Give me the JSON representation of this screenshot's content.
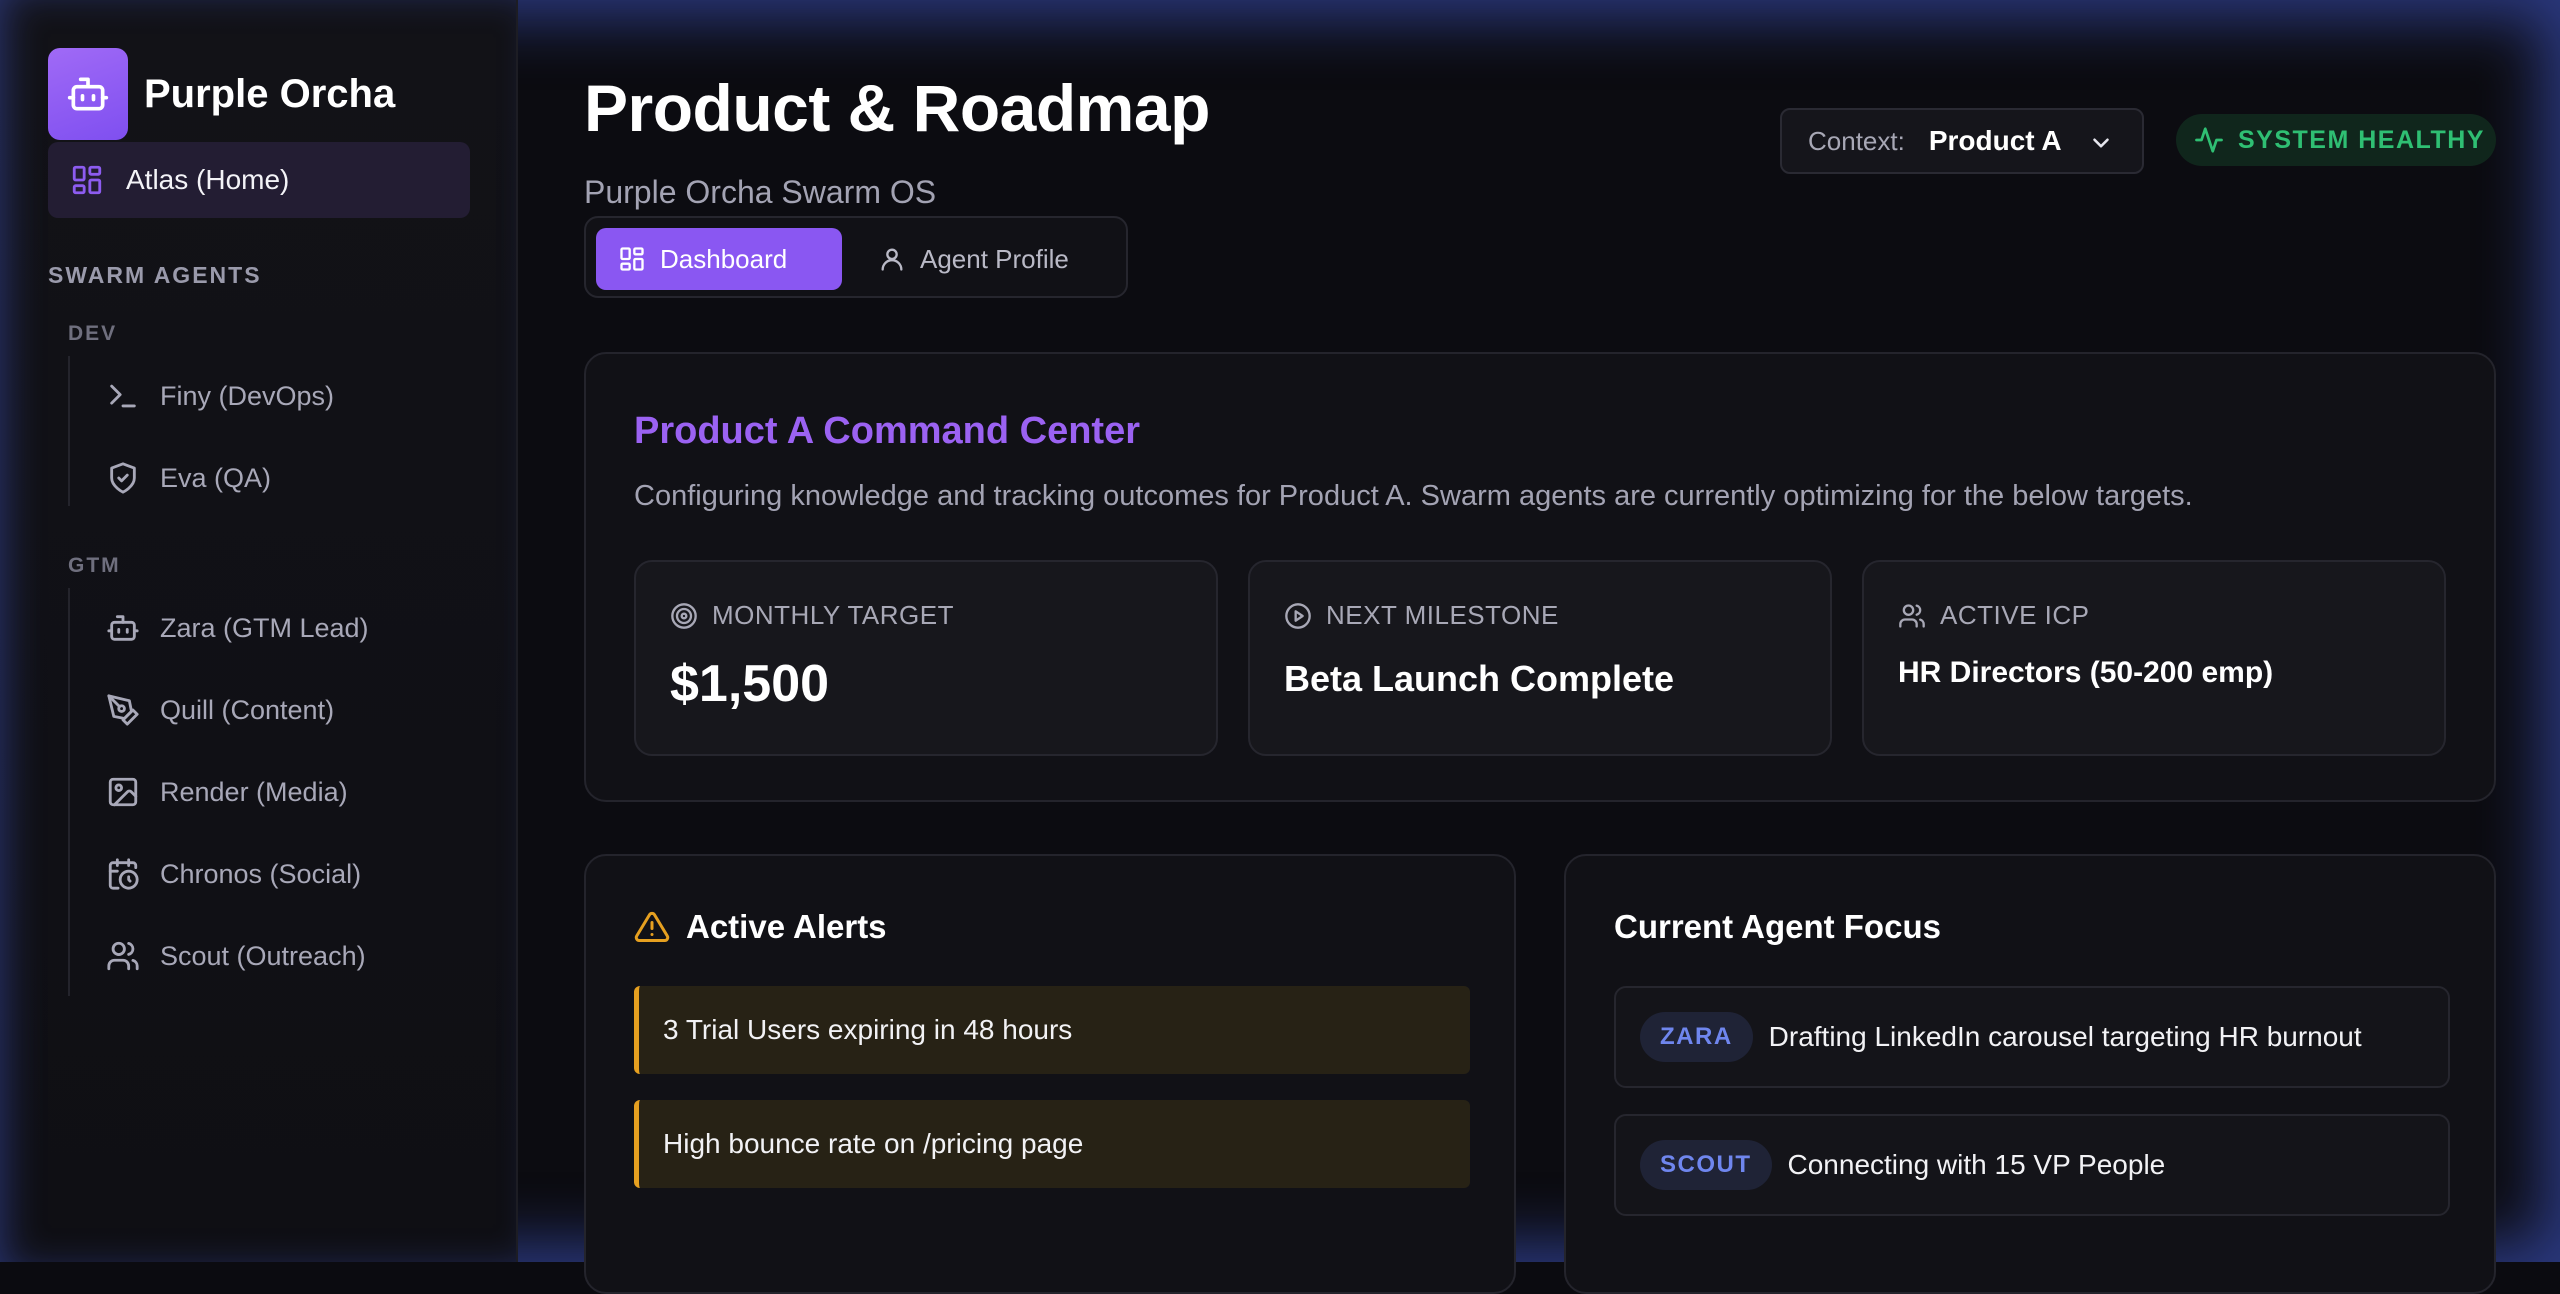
{
  "colors": {
    "accent": "#8a57f2",
    "accent_title": "#9b62f2",
    "healthy": "#2fbf73",
    "alert": "#e6a020",
    "agent_tag": "#6f86ee"
  },
  "sidebar": {
    "brand": "Purple Orcha",
    "brand_icon": "robot-icon",
    "home": {
      "label": "Atlas (Home)",
      "icon": "grid-icon"
    },
    "section_title": "SWARM AGENTS",
    "groups": [
      {
        "title": "DEV",
        "items": [
          {
            "label": "Finy (DevOps)",
            "icon": "terminal-icon"
          },
          {
            "label": "Eva (QA)",
            "icon": "shield-icon"
          }
        ]
      },
      {
        "title": "GTM",
        "items": [
          {
            "label": "Zara (GTM Lead)",
            "icon": "robot-icon"
          },
          {
            "label": "Quill (Content)",
            "icon": "pen-icon"
          },
          {
            "label": "Render (Media)",
            "icon": "image-icon"
          },
          {
            "label": "Chronos (Social)",
            "icon": "calendar-clock-icon"
          },
          {
            "label": "Scout (Outreach)",
            "icon": "users-icon"
          }
        ]
      }
    ]
  },
  "header": {
    "title": "Product & Roadmap",
    "subtitle": "Purple Orcha Swarm OS",
    "tabs": [
      {
        "label": "Dashboard",
        "icon": "grid-icon",
        "active": true
      },
      {
        "label": "Agent Profile",
        "icon": "user-icon",
        "active": false
      }
    ],
    "context_label": "Context:",
    "context_value": "Product A",
    "status": "SYSTEM HEALTHY"
  },
  "command_center": {
    "title": "Product A Command Center",
    "description": "Configuring knowledge and tracking outcomes for Product A. Swarm agents are currently optimizing for the below targets.",
    "metrics": [
      {
        "label": "MONTHLY TARGET",
        "value": "$1,500",
        "icon": "target-icon"
      },
      {
        "label": "NEXT MILESTONE",
        "value": "Beta Launch Complete",
        "icon": "play-circle-icon"
      },
      {
        "label": "ACTIVE ICP",
        "value": "HR Directors (50-200 emp)",
        "icon": "users-icon"
      }
    ]
  },
  "alerts": {
    "title": "Active Alerts",
    "items": [
      "3 Trial Users expiring in 48 hours",
      "High bounce rate on /pricing page"
    ]
  },
  "focus": {
    "title": "Current Agent Focus",
    "items": [
      {
        "agent": "ZARA",
        "text": "Drafting LinkedIn carousel targeting HR burnout"
      },
      {
        "agent": "SCOUT",
        "text": "Connecting with 15 VP People"
      }
    ]
  }
}
